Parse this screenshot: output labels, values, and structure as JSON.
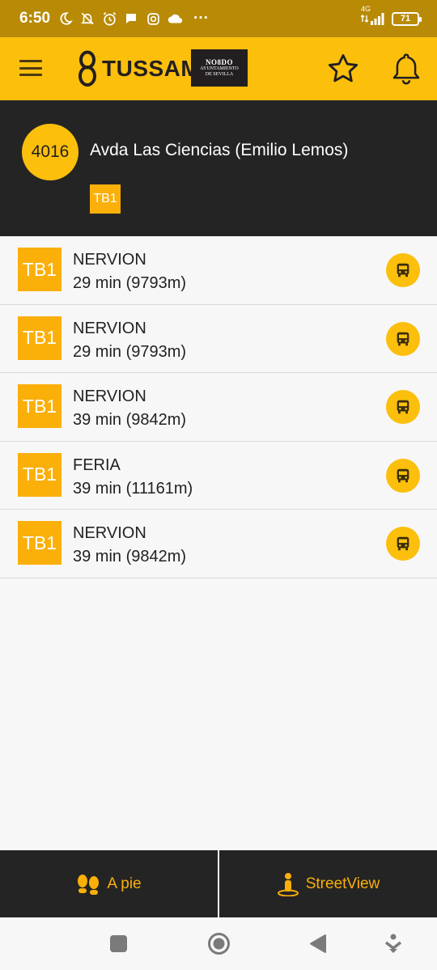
{
  "status_bar": {
    "time": "6:50",
    "network": "4G",
    "battery": "71",
    "more": "···",
    "icons": [
      "moon-icon",
      "bell-off-icon",
      "alarm-icon",
      "chat-icon",
      "instagram-icon",
      "cloud-icon",
      "signal-icon",
      "battery-icon"
    ]
  },
  "app_bar": {
    "logo_text": "TUSSAM",
    "nodo_title": "NO8DO",
    "nodo_sub1": "AYUNTAMIENTO",
    "nodo_sub2": "DE SEVILLA",
    "icons": [
      "menu-icon",
      "star-icon",
      "bell-icon"
    ]
  },
  "stop": {
    "number": "4016",
    "name": "Avda Las Ciencias (Emilio Lemos)",
    "line": "TB1"
  },
  "arrivals": [
    {
      "line": "TB1",
      "destination": "NERVION",
      "eta": "29 min (9793m)"
    },
    {
      "line": "TB1",
      "destination": "NERVION",
      "eta": "29 min (9793m)"
    },
    {
      "line": "TB1",
      "destination": "NERVION",
      "eta": "39 min (9842m)"
    },
    {
      "line": "TB1",
      "destination": "FERIA",
      "eta": "39 min (11161m)"
    },
    {
      "line": "TB1",
      "destination": "NERVION",
      "eta": "39 min (9842m)"
    }
  ],
  "bottom_bar": {
    "walk_label": "A pie",
    "streetview_label": "StreetView"
  },
  "colors": {
    "brand_yellow": "#fbbf0c",
    "badge_orange": "#fbaf09",
    "dark": "#242424",
    "status_bar": "#b88a06"
  }
}
